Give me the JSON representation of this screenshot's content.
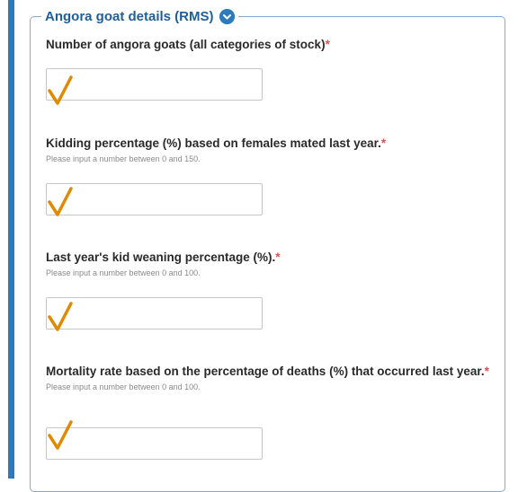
{
  "section": {
    "title": "Angora goat details (RMS)",
    "collapse_icon": "minus-circle-icon"
  },
  "questions": [
    {
      "label": "Number of angora goats (all categories of stock)",
      "required_mark": "*",
      "hint": "",
      "value": ""
    },
    {
      "label": "Kidding percentage (%) based on females mated last year.",
      "required_mark": "*",
      "hint": "Please input a number between 0 and 150.",
      "value": ""
    },
    {
      "label": "Last year's kid weaning percentage (%).",
      "required_mark": "*",
      "hint": "Please input a number between 0 and 100.",
      "value": ""
    },
    {
      "label": "Mortality rate based on the percentage of deaths (%) that occurred last year.",
      "required_mark": "*",
      "hint": "Please input a number between 0 and 100.",
      "value": ""
    }
  ],
  "annotations": {
    "icon": "checkmark-icon",
    "color": "#e08a00"
  },
  "colors": {
    "accent": "#2b7bbd",
    "legend_text": "#1f5f99",
    "required": "#d9534f"
  }
}
